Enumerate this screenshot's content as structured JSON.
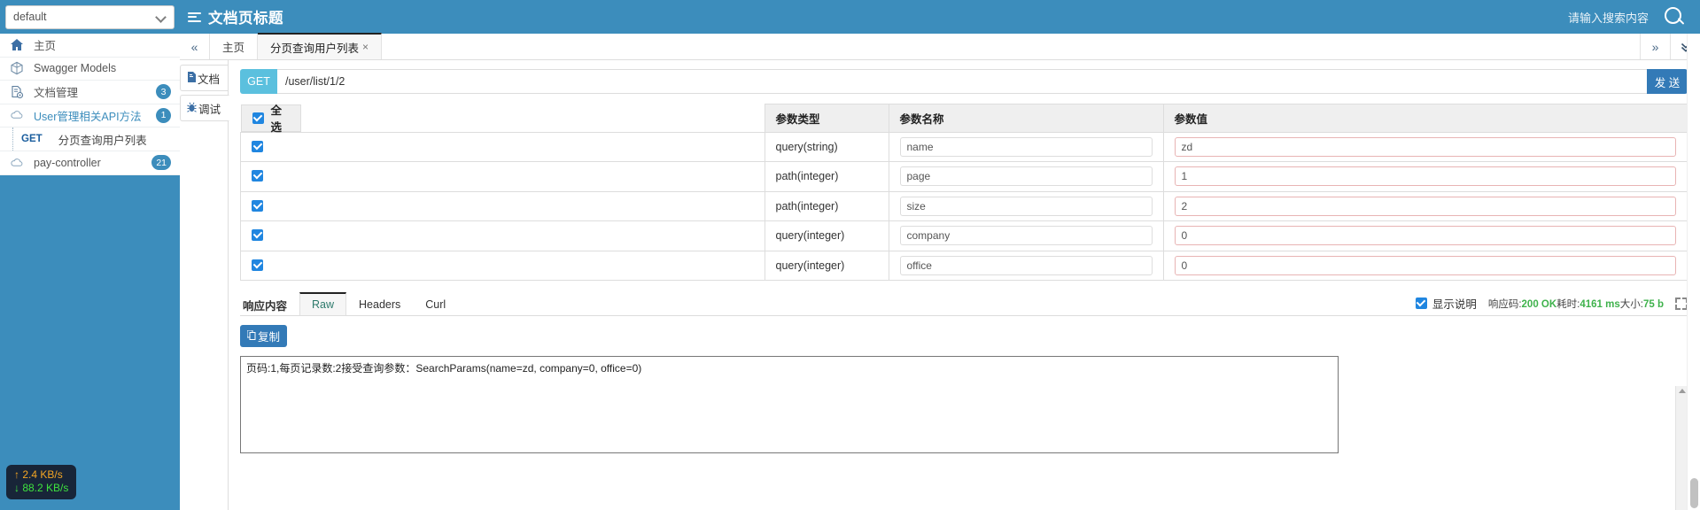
{
  "topbar": {
    "group_select_value": "default",
    "group_select_icon": "chevron-down-icon",
    "title": "文档页标题",
    "title_icon": "list-icon",
    "search_placeholder": "请输入搜索内容",
    "search_icon": "search-icon",
    "bg_color": "#3c8dbc"
  },
  "sidebar": {
    "items": [
      {
        "label": "主页",
        "icon": "home-icon",
        "badge": "",
        "style": "plain"
      },
      {
        "label": "Swagger Models",
        "icon": "cube-icon",
        "badge": "",
        "style": "plain"
      },
      {
        "label": "文档管理",
        "icon": "doc-gear-icon",
        "badge": "3",
        "style": "plain"
      },
      {
        "label": "User管理相关API方法",
        "icon": "cloud-icon",
        "badge": "1",
        "style": "link"
      }
    ],
    "sub_item": {
      "method": "GET",
      "label": "分页查询用户列表"
    },
    "last_item": {
      "label": "pay-controller",
      "icon": "cloud-icon",
      "badge": "21",
      "style": "plain"
    },
    "network_monitor": {
      "upload": "↑ 2.4 KB/s",
      "download": "↓ 88.2 KB/s",
      "upload_color": "#f5a623",
      "download_color": "#3ee23e"
    }
  },
  "tabstrip": {
    "collapse_left_icon": "chevron-double-left-icon",
    "tabs": [
      {
        "label": "主页",
        "active": false,
        "closable": false
      },
      {
        "label": "分页查询用户列表",
        "active": true,
        "closable": true,
        "close_glyph": "×"
      }
    ],
    "right_icons": [
      {
        "name": "chevron-double-right-icon",
        "glyph": "»"
      },
      {
        "name": "chevron-double-down-icon",
        "glyph": "⌄"
      }
    ]
  },
  "vertical_tabs": [
    {
      "label": "文档",
      "icon": "document-icon",
      "active": false
    },
    {
      "label": "调试",
      "icon": "bug-icon",
      "active": true
    }
  ],
  "request": {
    "method": "GET",
    "method_color": "#5bc0de",
    "url": "/user/list/1/2",
    "send_label": "发 送",
    "send_color": "#337ab7"
  },
  "params_table": {
    "headers": {
      "select_all": "全选",
      "type": "参数类型",
      "name": "参数名称",
      "value": "参数值"
    },
    "rows": [
      {
        "checked": true,
        "type": "query(string)",
        "name": "name",
        "value": "zd"
      },
      {
        "checked": true,
        "type": "path(integer)",
        "name": "page",
        "value": "1"
      },
      {
        "checked": true,
        "type": "path(integer)",
        "name": "size",
        "value": "2"
      },
      {
        "checked": true,
        "type": "query(integer)",
        "name": "company",
        "value": "0"
      },
      {
        "checked": true,
        "type": "query(integer)",
        "name": "office",
        "value": "0"
      }
    ]
  },
  "response": {
    "section_label": "响应内容",
    "tabs": [
      {
        "label": "Raw",
        "active": true
      },
      {
        "label": "Headers",
        "active": false
      },
      {
        "label": "Curl",
        "active": false
      }
    ],
    "show_desc_label": "显示说明",
    "show_desc_checked": true,
    "status_prefix": "响应码:",
    "status_code": "200 OK",
    "time_prefix": "耗时:",
    "time_value": "4161 ms",
    "size_prefix": "大小:",
    "size_value": "75 b",
    "status_ok_color": "#3fb24c",
    "expand_icon": "expand-icon",
    "copy_label": "复制",
    "copy_icon": "copy-icon",
    "body": "页码:1,每页记录数:2接受查询参数：SearchParams(name=zd, company=0, office=0)"
  }
}
